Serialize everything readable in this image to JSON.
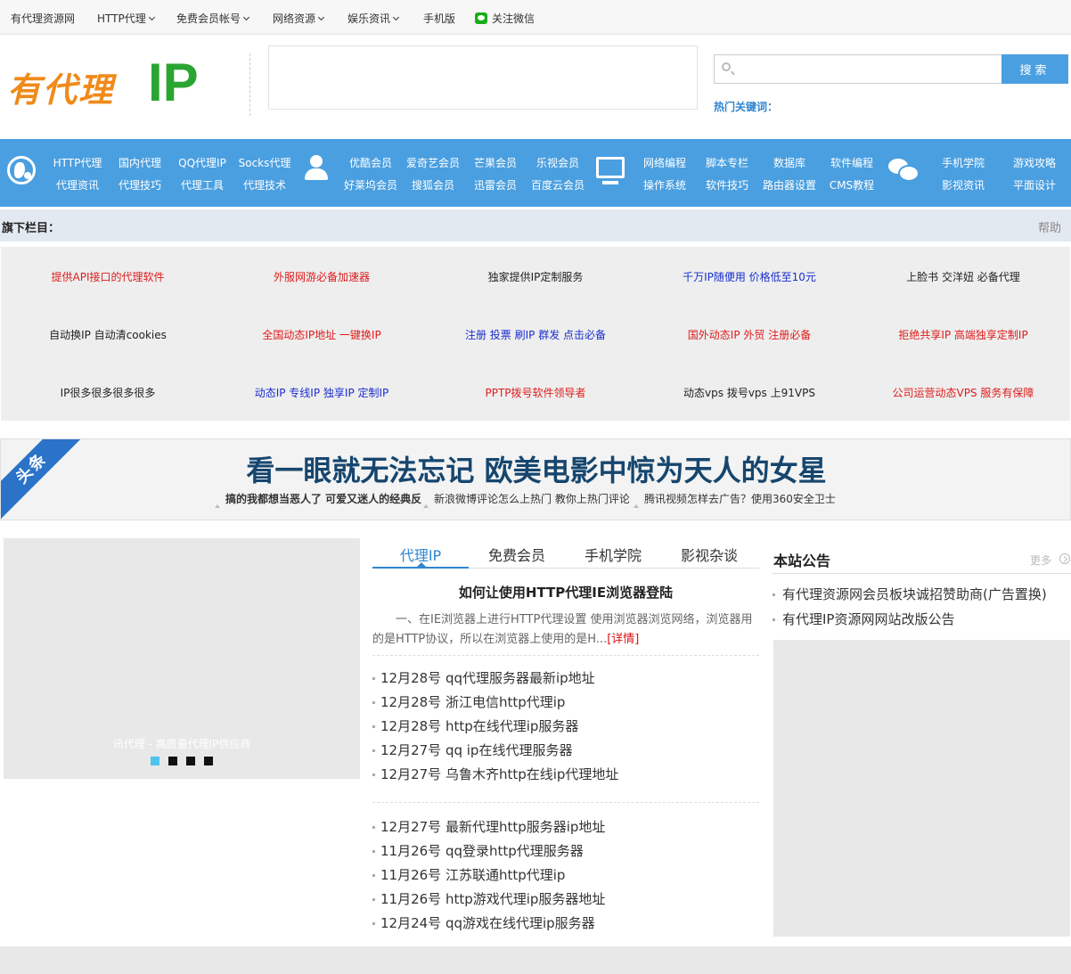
{
  "topbar": {
    "items": [
      {
        "label": "有代理资源网",
        "dropdown": false
      },
      {
        "label": "HTTP代理",
        "dropdown": true
      },
      {
        "label": "免费会员帐号",
        "dropdown": true
      },
      {
        "label": "网络资源",
        "dropdown": true
      },
      {
        "label": "娱乐资讯",
        "dropdown": true
      },
      {
        "label": "手机版",
        "dropdown": false
      }
    ],
    "wechat_label": "关注微信",
    "wechat_color": "#1aad19"
  },
  "header": {
    "logo_text_cn": "有代理",
    "logo_text_ip": "IP",
    "search_placeholder": "",
    "search_button": "搜索",
    "hot_keywords_label": "热门关键词："
  },
  "mainnav": {
    "color": "#4a9fe0",
    "groups": [
      {
        "icon": "globe-icon",
        "rows": [
          [
            "HTTP代理",
            "国内代理",
            "QQ代理IP",
            "Socks代理"
          ],
          [
            "代理资讯",
            "代理技巧",
            "代理工具",
            "代理技术"
          ]
        ]
      },
      {
        "icon": "user-icon",
        "rows": [
          [
            "优酷会员",
            "爱奇艺会员",
            "芒果会员",
            "乐视会员"
          ],
          [
            "好莱坞会员",
            "搜狐会员",
            "迅雷会员",
            "百度云会员"
          ]
        ]
      },
      {
        "icon": "monitor-icon",
        "rows": [
          [
            "网络编程",
            "脚本专栏",
            "数据库",
            "软件编程"
          ],
          [
            "操作系统",
            "软件技巧",
            "路由器设置",
            "CMS教程"
          ]
        ]
      },
      {
        "icon": "chat-icon",
        "rows": [
          [
            "手机学院",
            "游戏攻略"
          ],
          [
            "影视资讯",
            "平面设计"
          ]
        ]
      }
    ]
  },
  "section": {
    "title": "旗下栏目：",
    "help": "帮助"
  },
  "ad_grid": [
    [
      {
        "text": "提供API接口的代理软件",
        "color": "#e01b1b"
      },
      {
        "text": "外服网游必备加速器",
        "color": "#e01b1b"
      },
      {
        "text": "独家提供IP定制服务",
        "color": "#222222"
      },
      {
        "text": "千万IP随便用 价格低至10元",
        "color": "#1a2ecf"
      },
      {
        "text": "上脸书 交洋妞 必备代理",
        "color": "#222222"
      }
    ],
    [
      {
        "text": "自动换IP 自动清cookies",
        "color": "#222222"
      },
      {
        "text": "全国动态IP地址 一键换IP",
        "color": "#e01b1b"
      },
      {
        "text": "注册 投票 刷IP 群发 点击必备",
        "color": "#1a2ecf"
      },
      {
        "text": "国外动态IP 外贸 注册必备",
        "color": "#e01b1b"
      },
      {
        "text": "拒绝共享IP 高端独享定制IP",
        "color": "#e01b1b"
      }
    ],
    [
      {
        "text": "IP很多很多很多很多",
        "color": "#222222"
      },
      {
        "text": "动态IP 专线IP 独享IP 定制IP",
        "color": "#1a2ecf"
      },
      {
        "text": "PPTP拨号软件领导者",
        "color": "#e01b1b"
      },
      {
        "text": "动态vps 拨号vps 上91VPS",
        "color": "#222222"
      },
      {
        "text": "公司运营动态VPS 服务有保障",
        "color": "#e01b1b"
      }
    ]
  ],
  "headline": {
    "badge": "头条",
    "title": "看一眼就无法忘记 欧美电影中惊为天人的女星",
    "subs": [
      "搞的我都想当恶人了 可爱又迷人的经典反",
      "新浪微博评论怎么上热门 教你上热门评论",
      "腾讯视频怎样去广告？使用360安全卫士"
    ]
  },
  "slider": {
    "caption": "讯代理 - 高质量代理IP供应商",
    "dots": 4,
    "active_dot": 0
  },
  "tabs": {
    "items": [
      "代理IP",
      "免费会员",
      "手机学院",
      "影视杂谈"
    ],
    "active": 0
  },
  "article": {
    "title": "如何让使用HTTP代理IE浏览器登陆",
    "summary": "一、在IE浏览器上进行HTTP代理设置 使用浏览器浏览网络，浏览器用的是HTTP协议，所以在浏览器上使用的是H...",
    "more": "[详情]"
  },
  "list1": [
    "12月28号 qq代理服务器最新ip地址",
    "12月28号 浙江电信http代理ip",
    "12月28号 http在线代理ip服务器",
    "12月27号 qq ip在线代理服务器",
    "12月27号 乌鲁木齐http在线ip代理地址"
  ],
  "list2": [
    "12月27号 最新代理http服务器ip地址",
    "11月26号 qq登录http代理服务器",
    "11月26号 江苏联通http代理ip",
    "11月26号 http游戏代理ip服务器地址",
    "12月24号 qq游戏在线代理ip服务器"
  ],
  "notice": {
    "title": "本站公告",
    "more": "更多",
    "items": [
      "有代理资源网会员板块诚招赞助商(广告置换)",
      "有代理IP资源网网站改版公告"
    ]
  }
}
